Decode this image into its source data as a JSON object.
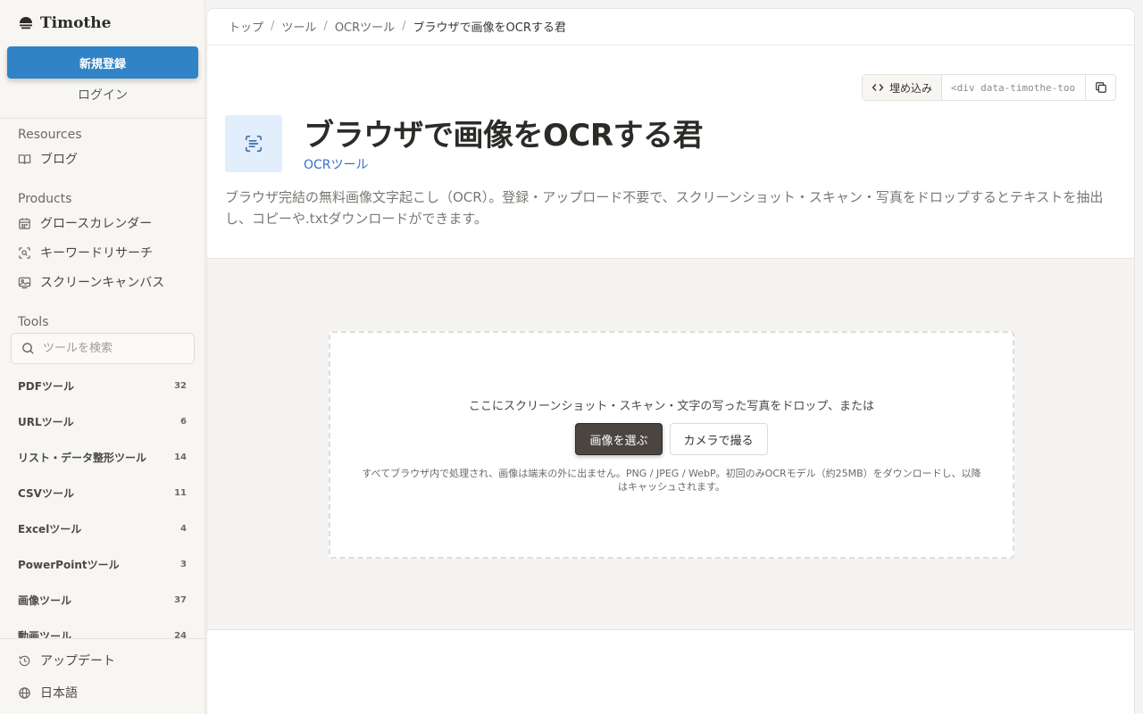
{
  "sidebar": {
    "brand": "Timothe",
    "signup_label": "新規登録",
    "login_label": "ログイン",
    "resources": {
      "title": "Resources",
      "items": [
        {
          "label": "ブログ",
          "icon": "book-open-icon"
        }
      ]
    },
    "products": {
      "title": "Products",
      "items": [
        {
          "label": "グロースカレンダー",
          "icon": "calendar-icon"
        },
        {
          "label": "キーワードリサーチ",
          "icon": "scan-search-icon"
        },
        {
          "label": "スクリーンキャンバス",
          "icon": "image-frame-icon"
        }
      ]
    },
    "tools": {
      "title": "Tools",
      "search_placeholder": "ツールを検索",
      "items": [
        {
          "label": "PDFツール",
          "count": "32"
        },
        {
          "label": "URLツール",
          "count": "6"
        },
        {
          "label": "リスト・データ整形ツール",
          "count": "14"
        },
        {
          "label": "CSVツール",
          "count": "11"
        },
        {
          "label": "Excelツール",
          "count": "4"
        },
        {
          "label": "PowerPointツール",
          "count": "3"
        },
        {
          "label": "画像ツール",
          "count": "37"
        },
        {
          "label": "動画ツール",
          "count": "24"
        }
      ]
    },
    "footer": {
      "updates_label": "アップデート",
      "language_label": "日本語"
    }
  },
  "breadcrumb": {
    "items": [
      "トップ",
      "ツール",
      "OCRツール"
    ],
    "current": "ブラウザで画像をOCRする君",
    "separator": "/"
  },
  "embed": {
    "button_label": "埋め込み",
    "code_value": "<div data-timothe-tool"
  },
  "header": {
    "title": "ブラウザで画像をOCRする君",
    "category": "OCRツール",
    "description": "ブラウザ完結の無料画像文字起こし（OCR）。登録・アップロード不要で、スクリーンショット・スキャン・写真をドロップするとテキストを抽出し、コピーや.txtダウンロードができます。"
  },
  "dropzone": {
    "prompt": "ここにスクリーンショット・スキャン・文字の写った写真をドロップ、または",
    "choose_label": "画像を選ぶ",
    "camera_label": "カメラで撮る",
    "note": "すべてブラウザ内で処理され、画像は端末の外に出ません。PNG / JPEG / WebP。初回のみOCRモデル（約25MB）をダウンロードし、以降はキャッシュされます。"
  },
  "colors": {
    "accent": "#2f83c6",
    "link": "#3a6fc4",
    "icon_bg": "#e3eefc",
    "primary_button": "#4a4540"
  }
}
